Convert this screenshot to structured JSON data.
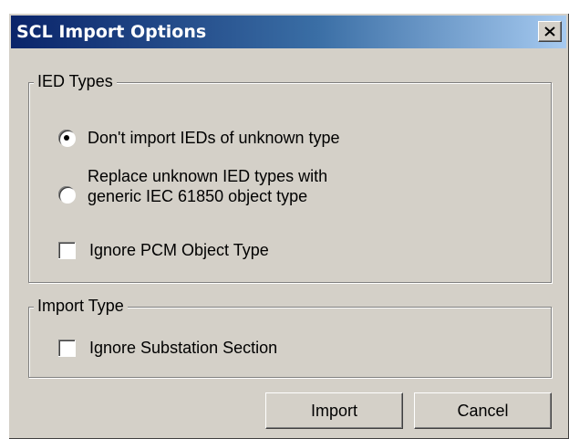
{
  "window": {
    "title": "SCL Import Options",
    "close_icon": "close-x-icon"
  },
  "ied_types": {
    "legend": "IED Types",
    "option_dont_import": "Don't import IEDs of unknown type",
    "option_replace_line1": "Replace unknown IED types with",
    "option_replace_line2": "generic IEC 61850 object type",
    "ignore_pcm": "Ignore PCM Object Type",
    "selected": "dont_import",
    "ignore_pcm_checked": false
  },
  "import_type": {
    "legend": "Import Type",
    "ignore_substation": "Ignore Substation Section",
    "ignore_substation_checked": false
  },
  "buttons": {
    "import": "Import",
    "cancel": "Cancel"
  }
}
